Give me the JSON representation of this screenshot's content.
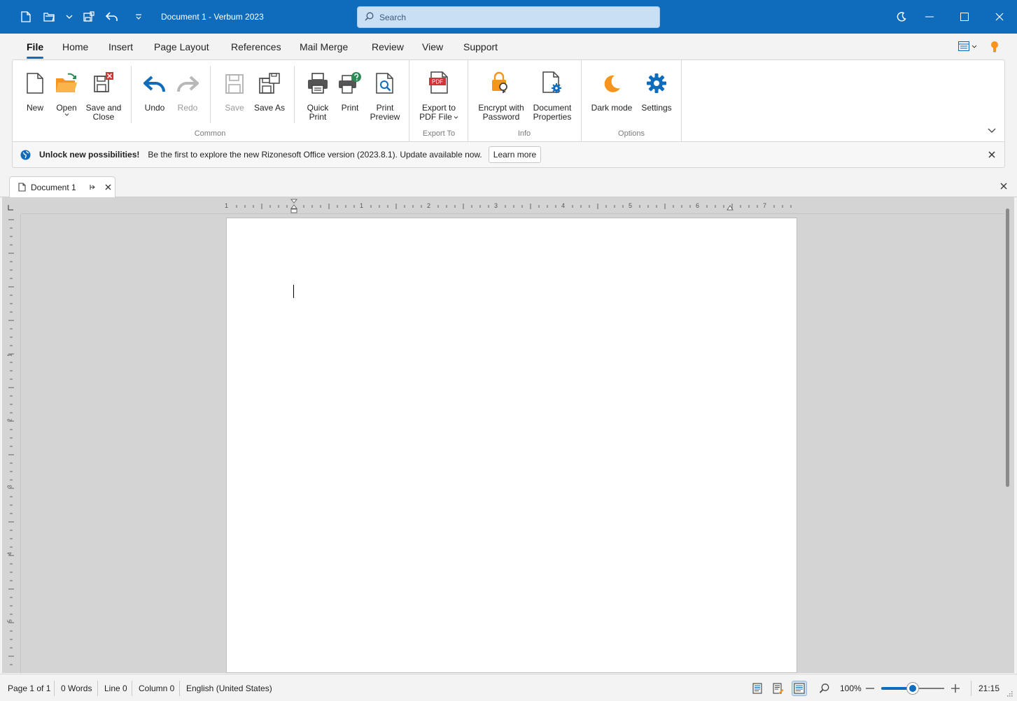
{
  "titlebar": {
    "title": "Document 1 - Verbum 2023",
    "search_placeholder": "Search"
  },
  "menu_tabs": [
    "File",
    "Home",
    "Insert",
    "Page Layout",
    "References",
    "Mail Merge",
    "Review",
    "View",
    "Support"
  ],
  "active_tab": "File",
  "ribbon": {
    "new": "New",
    "open": "Open",
    "save_and_close_1": "Save and",
    "save_and_close_2": "Close",
    "undo": "Undo",
    "redo": "Redo",
    "save": "Save",
    "save_as": "Save As",
    "quick_print_1": "Quick",
    "quick_print_2": "Print",
    "print": "Print",
    "print_preview_1": "Print",
    "print_preview_2": "Preview",
    "export_pdf_1": "Export to",
    "export_pdf_2": "PDF File",
    "encrypt_1": "Encrypt with",
    "encrypt_2": "Password",
    "docprops_1": "Document",
    "docprops_2": "Properties",
    "dark_mode": "Dark mode",
    "settings": "Settings",
    "groups": {
      "common": "Common",
      "export_to": "Export To",
      "info": "Info",
      "options": "Options"
    },
    "pdf_badge": "PDF"
  },
  "notification": {
    "title": "Unlock new possibilities!",
    "message": "Be the first to explore the new Rizonesoft Office version (2023.8.1). Update available now.",
    "button": "Learn more"
  },
  "document_tab": {
    "name": "Document 1"
  },
  "ruler": {
    "h_labels": [
      "1",
      "1",
      "2",
      "3",
      "4",
      "5",
      "6",
      "7"
    ],
    "v_labels": [
      "1",
      "2",
      "3",
      "4",
      "5"
    ]
  },
  "statusbar": {
    "page": "Page 1 of 1",
    "words": "0 Words",
    "line": "Line 0",
    "column": "Column 0",
    "language": "English (United States)",
    "zoom": "100%",
    "zoom_level": 0.5,
    "time": "21:15"
  },
  "colors": {
    "accent": "#0f6cbd",
    "pdf_red": "#d13438",
    "orange": "#f7941d"
  }
}
